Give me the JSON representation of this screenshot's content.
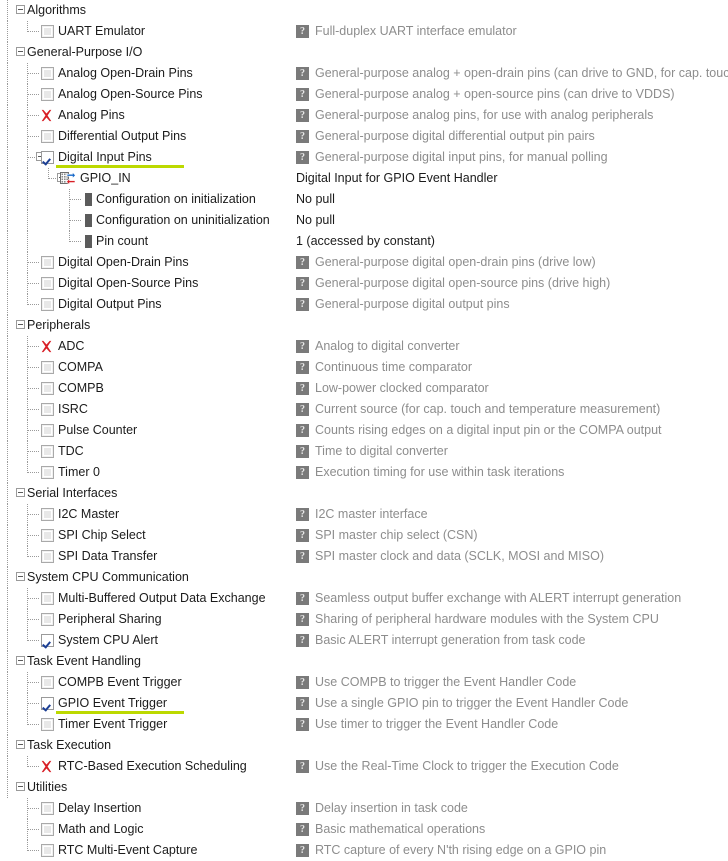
{
  "colors": {
    "highlight_underline": "#bcd900",
    "checkbox_check": "#1c3f94",
    "error_icon": "#d81f26",
    "muted_text": "#8d8d8d",
    "normal_text": "#1b1b1b",
    "help_icon_bg": "#7a7a7a"
  },
  "icons": {
    "help": "?",
    "error": "red-x-icon",
    "gpio_module": "gpio-module-icon",
    "property": "property-bar-icon"
  },
  "rows": [
    {
      "id": "algorithms",
      "label": "Algorithms",
      "kind": "group",
      "indent": 0,
      "expander": "minus",
      "desc": "",
      "desc_icon": false
    },
    {
      "id": "uart-emulator",
      "label": "UART Emulator",
      "kind": "item",
      "indent": 1,
      "checkbox": "unchecked",
      "desc": "Full-duplex UART interface emulator",
      "desc_icon": true,
      "desc_muted": true
    },
    {
      "id": "general-purpose-io",
      "label": "General-Purpose I/O",
      "kind": "group",
      "indent": 0,
      "expander": "minus",
      "desc": "",
      "desc_icon": false
    },
    {
      "id": "analog-open-drain-pins",
      "label": "Analog Open-Drain Pins",
      "kind": "item",
      "indent": 1,
      "checkbox": "unchecked",
      "desc": "General-purpose analog + open-drain pins (can drive to GND, for cap. touch)",
      "desc_icon": true,
      "desc_muted": true
    },
    {
      "id": "analog-open-source-pins",
      "label": "Analog Open-Source Pins",
      "kind": "item",
      "indent": 1,
      "checkbox": "unchecked",
      "desc": "General-purpose analog + open-source pins (can drive to VDDS)",
      "desc_icon": true,
      "desc_muted": true
    },
    {
      "id": "analog-pins",
      "label": "Analog Pins",
      "kind": "item",
      "indent": 1,
      "checkbox": "error",
      "desc": "General-purpose analog pins, for use with analog peripherals",
      "desc_icon": true,
      "desc_muted": true
    },
    {
      "id": "differential-output-pins",
      "label": "Differential Output Pins",
      "kind": "item",
      "indent": 1,
      "checkbox": "unchecked",
      "desc": "General-purpose digital differential output pin pairs",
      "desc_icon": true,
      "desc_muted": true
    },
    {
      "id": "digital-input-pins",
      "label": "Digital Input Pins",
      "kind": "item",
      "indent": 1,
      "checkbox": "checked",
      "expander": "minus",
      "highlighted": true,
      "desc": "General-purpose digital input pins, for manual polling",
      "desc_icon": true,
      "desc_muted": true
    },
    {
      "id": "gpio-in",
      "label": "GPIO_IN",
      "kind": "module",
      "indent": 2,
      "expander": "minus",
      "desc": "Digital Input for GPIO Event Handler",
      "desc_icon": false,
      "desc_muted": false
    },
    {
      "id": "configuration-on-initialization",
      "label": "Configuration on initialization",
      "kind": "property",
      "indent": 3,
      "desc": "No pull",
      "desc_icon": false,
      "desc_muted": false
    },
    {
      "id": "configuration-on-uninitialization",
      "label": "Configuration on uninitialization",
      "kind": "property",
      "indent": 3,
      "desc": "No pull",
      "desc_icon": false,
      "desc_muted": false
    },
    {
      "id": "pin-count",
      "label": "Pin count",
      "kind": "property",
      "indent": 3,
      "desc": "1 (accessed by constant)",
      "desc_icon": false,
      "desc_muted": false
    },
    {
      "id": "digital-open-drain-pins",
      "label": "Digital Open-Drain Pins",
      "kind": "item",
      "indent": 1,
      "checkbox": "unchecked",
      "desc": "General-purpose digital open-drain pins (drive low)",
      "desc_icon": true,
      "desc_muted": true
    },
    {
      "id": "digital-open-source-pins",
      "label": "Digital Open-Source Pins",
      "kind": "item",
      "indent": 1,
      "checkbox": "unchecked",
      "desc": "General-purpose digital open-source pins (drive high)",
      "desc_icon": true,
      "desc_muted": true
    },
    {
      "id": "digital-output-pins",
      "label": "Digital Output Pins",
      "kind": "item",
      "indent": 1,
      "checkbox": "unchecked",
      "desc": "General-purpose digital output pins",
      "desc_icon": true,
      "desc_muted": true
    },
    {
      "id": "peripherals",
      "label": "Peripherals",
      "kind": "group",
      "indent": 0,
      "expander": "minus",
      "desc": "",
      "desc_icon": false
    },
    {
      "id": "adc",
      "label": "ADC",
      "kind": "item",
      "indent": 1,
      "checkbox": "error",
      "desc": "Analog to digital converter",
      "desc_icon": true,
      "desc_muted": true
    },
    {
      "id": "compa",
      "label": "COMPA",
      "kind": "item",
      "indent": 1,
      "checkbox": "unchecked",
      "desc": "Continuous time comparator",
      "desc_icon": true,
      "desc_muted": true
    },
    {
      "id": "compb",
      "label": "COMPB",
      "kind": "item",
      "indent": 1,
      "checkbox": "unchecked",
      "desc": "Low-power clocked comparator",
      "desc_icon": true,
      "desc_muted": true
    },
    {
      "id": "isrc",
      "label": "ISRC",
      "kind": "item",
      "indent": 1,
      "checkbox": "unchecked",
      "desc": "Current source (for cap. touch and temperature measurement)",
      "desc_icon": true,
      "desc_muted": true
    },
    {
      "id": "pulse-counter",
      "label": "Pulse Counter",
      "kind": "item",
      "indent": 1,
      "checkbox": "unchecked",
      "desc": "Counts rising edges on a digital input pin or the COMPA output",
      "desc_icon": true,
      "desc_muted": true
    },
    {
      "id": "tdc",
      "label": "TDC",
      "kind": "item",
      "indent": 1,
      "checkbox": "unchecked",
      "desc": "Time to digital converter",
      "desc_icon": true,
      "desc_muted": true
    },
    {
      "id": "timer-0",
      "label": "Timer 0",
      "kind": "item",
      "indent": 1,
      "checkbox": "unchecked",
      "desc": "Execution timing for use within task iterations",
      "desc_icon": true,
      "desc_muted": true
    },
    {
      "id": "serial-interfaces",
      "label": "Serial Interfaces",
      "kind": "group",
      "indent": 0,
      "expander": "minus",
      "desc": "",
      "desc_icon": false
    },
    {
      "id": "i2c-master",
      "label": "I2C Master",
      "kind": "item",
      "indent": 1,
      "checkbox": "unchecked",
      "desc": "I2C master interface",
      "desc_icon": true,
      "desc_muted": true
    },
    {
      "id": "spi-chip-select",
      "label": "SPI Chip Select",
      "kind": "item",
      "indent": 1,
      "checkbox": "unchecked",
      "desc": "SPI master chip select (CSN)",
      "desc_icon": true,
      "desc_muted": true
    },
    {
      "id": "spi-data-transfer",
      "label": "SPI Data Transfer",
      "kind": "item",
      "indent": 1,
      "checkbox": "unchecked",
      "desc": "SPI master clock and data (SCLK, MOSI and MISO)",
      "desc_icon": true,
      "desc_muted": true
    },
    {
      "id": "system-cpu-communication",
      "label": "System CPU Communication",
      "kind": "group",
      "indent": 0,
      "expander": "minus",
      "desc": "",
      "desc_icon": false
    },
    {
      "id": "multi-buffered-output-data-exchange",
      "label": "Multi-Buffered Output Data Exchange",
      "kind": "item",
      "indent": 1,
      "checkbox": "unchecked",
      "desc": "Seamless output buffer exchange with ALERT interrupt generation",
      "desc_icon": true,
      "desc_muted": true
    },
    {
      "id": "peripheral-sharing",
      "label": "Peripheral Sharing",
      "kind": "item",
      "indent": 1,
      "checkbox": "unchecked",
      "desc": "Sharing of peripheral hardware modules with the System CPU",
      "desc_icon": true,
      "desc_muted": true
    },
    {
      "id": "system-cpu-alert",
      "label": "System CPU Alert",
      "kind": "item",
      "indent": 1,
      "checkbox": "checked",
      "desc": "Basic ALERT interrupt generation from task code",
      "desc_icon": true,
      "desc_muted": true
    },
    {
      "id": "task-event-handling",
      "label": "Task Event Handling",
      "kind": "group",
      "indent": 0,
      "expander": "minus",
      "desc": "",
      "desc_icon": false
    },
    {
      "id": "compb-event-trigger",
      "label": "COMPB Event Trigger",
      "kind": "item",
      "indent": 1,
      "checkbox": "unchecked",
      "desc": "Use COMPB to trigger the Event Handler Code",
      "desc_icon": true,
      "desc_muted": true
    },
    {
      "id": "gpio-event-trigger",
      "label": "GPIO Event Trigger",
      "kind": "item",
      "indent": 1,
      "checkbox": "checked",
      "highlighted": true,
      "desc": "Use a single GPIO pin to trigger the Event Handler Code",
      "desc_icon": true,
      "desc_muted": true
    },
    {
      "id": "timer-event-trigger",
      "label": "Timer Event Trigger",
      "kind": "item",
      "indent": 1,
      "checkbox": "unchecked",
      "desc": "Use timer to trigger the Event Handler Code",
      "desc_icon": true,
      "desc_muted": true
    },
    {
      "id": "task-execution",
      "label": "Task Execution",
      "kind": "group",
      "indent": 0,
      "expander": "minus",
      "desc": "",
      "desc_icon": false
    },
    {
      "id": "rtc-based-execution-scheduling",
      "label": "RTC-Based Execution Scheduling",
      "kind": "item",
      "indent": 1,
      "checkbox": "error",
      "desc": "Use the Real-Time Clock to trigger the Execution Code",
      "desc_icon": true,
      "desc_muted": true
    },
    {
      "id": "utilities",
      "label": "Utilities",
      "kind": "group",
      "indent": 0,
      "expander": "minus",
      "desc": "",
      "desc_icon": false
    },
    {
      "id": "delay-insertion",
      "label": "Delay Insertion",
      "kind": "item",
      "indent": 1,
      "checkbox": "unchecked",
      "desc": "Delay insertion in task code",
      "desc_icon": true,
      "desc_muted": true
    },
    {
      "id": "math-and-logic",
      "label": "Math and Logic",
      "kind": "item",
      "indent": 1,
      "checkbox": "unchecked",
      "desc": "Basic mathematical operations",
      "desc_icon": true,
      "desc_muted": true
    },
    {
      "id": "rtc-multi-event-capture",
      "label": "RTC Multi-Event Capture",
      "kind": "item",
      "indent": 1,
      "checkbox": "unchecked",
      "desc": "RTC capture of every N'th rising edge on a GPIO pin",
      "desc_icon": true,
      "desc_muted": true
    }
  ]
}
